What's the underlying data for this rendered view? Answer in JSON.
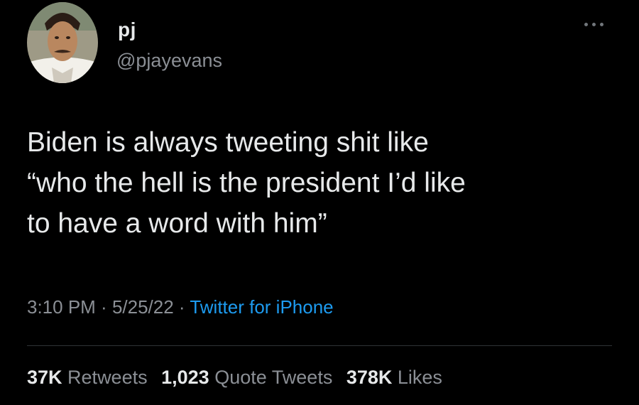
{
  "author": {
    "display_name": "pj",
    "handle": "@pjayevans",
    "avatar_icon": "profile-photo"
  },
  "menu": {
    "icon": "more-horizontal-icon"
  },
  "tweet": {
    "lines": [
      "Biden is always tweeting shit like",
      "“who the hell is the president I’d like",
      "to have a word with him”"
    ]
  },
  "meta": {
    "time": "3:10 PM",
    "sep1": " · ",
    "date": "5/25/22",
    "sep2": " · ",
    "source": "Twitter for iPhone"
  },
  "stats": {
    "retweets_count": "37K",
    "retweets_label": "Retweets",
    "quotes_count": "1,023",
    "quotes_label": "Quote Tweets",
    "likes_count": "378K",
    "likes_label": "Likes"
  },
  "colors": {
    "background": "#000000",
    "text_primary": "#e7e9ea",
    "text_secondary": "#8b8f95",
    "link": "#1d9bf0",
    "divider": "#2f3336"
  }
}
